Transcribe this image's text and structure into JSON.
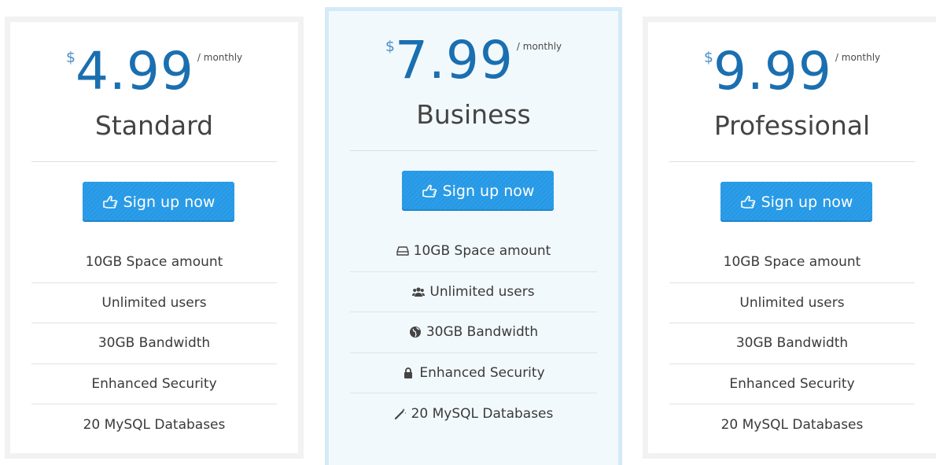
{
  "plans": [
    {
      "currency": "$",
      "price": "4.99",
      "period": "/ monthly",
      "name": "Standard",
      "button_label": "Sign up now",
      "features": [
        "10GB Space amount",
        "Unlimited users",
        "30GB Bandwidth",
        "Enhanced Security",
        "20 MySQL Databases"
      ]
    },
    {
      "currency": "$",
      "price": "7.99",
      "period": "/ monthly",
      "name": "Business",
      "button_label": "Sign up now",
      "features": [
        "10GB Space amount",
        "Unlimited users",
        "30GB Bandwidth",
        "Enhanced Security",
        "20 MySQL Databases"
      ],
      "feature_icons": [
        "hdd-icon",
        "users-icon",
        "globe-icon",
        "lock-icon",
        "magic-wand-icon"
      ],
      "highlighted": true
    },
    {
      "currency": "$",
      "price": "9.99",
      "period": "/ monthly",
      "name": "Professional",
      "button_label": "Sign up now",
      "features": [
        "10GB Space amount",
        "Unlimited users",
        "30GB Bandwidth",
        "Enhanced Security",
        "20 MySQL Databases"
      ]
    }
  ],
  "button_icon": "hand-pointer-icon",
  "colors": {
    "price": "#1a6fb0",
    "button": "#2d9fea",
    "highlight_bg": "#f2f9fd",
    "highlight_border": "#d4eaf8",
    "card_border": "#f2f2f2"
  }
}
